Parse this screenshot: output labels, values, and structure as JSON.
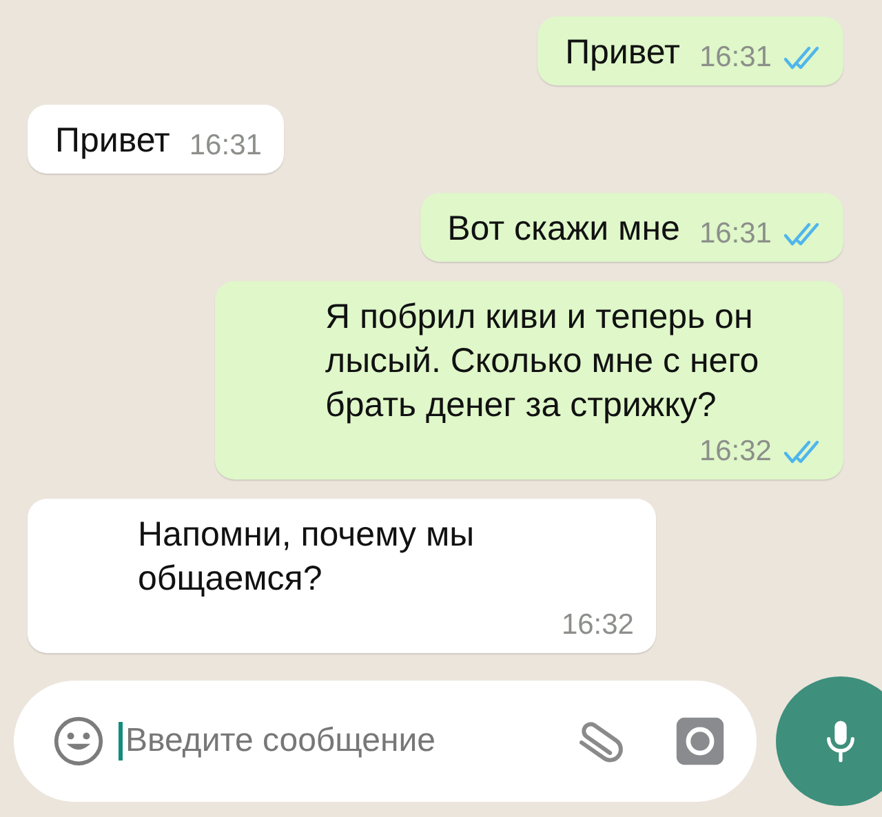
{
  "messages": [
    {
      "outgoing": true,
      "text": "Привет",
      "time": "16:31",
      "read": true
    },
    {
      "outgoing": false,
      "text": "Привет",
      "time": "16:31"
    },
    {
      "outgoing": true,
      "text": "Вот скажи мне",
      "time": "16:31",
      "read": true
    },
    {
      "outgoing": true,
      "text": "Я побрил киви и теперь он лысый. Сколько мне с него брать денег за стрижку?",
      "time": "16:32",
      "read": true
    },
    {
      "outgoing": false,
      "text": "Напомни, почему мы общаемся?",
      "time": "16:32"
    }
  ],
  "composer": {
    "placeholder": "Введите сообщение"
  }
}
